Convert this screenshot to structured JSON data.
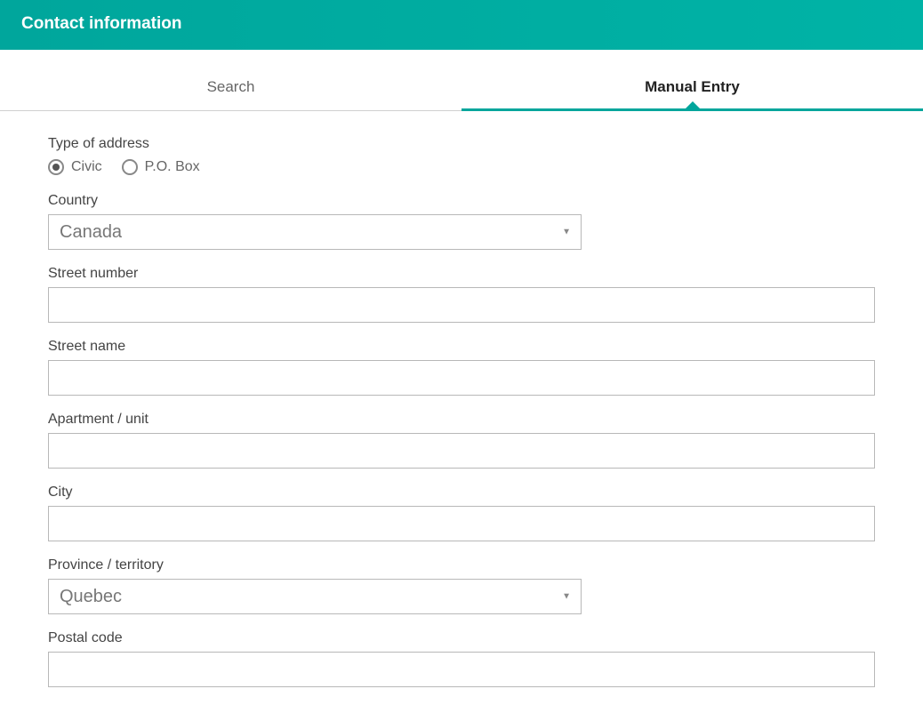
{
  "header": {
    "title": "Contact information"
  },
  "tabs": {
    "search": "Search",
    "manual": "Manual Entry"
  },
  "form": {
    "type_of_address": {
      "label": "Type of address",
      "options": {
        "civic": "Civic",
        "pobox": "P.O. Box"
      }
    },
    "country": {
      "label": "Country",
      "value": "Canada"
    },
    "street_number": {
      "label": "Street number",
      "value": ""
    },
    "street_name": {
      "label": "Street name",
      "value": ""
    },
    "apartment": {
      "label": "Apartment / unit",
      "value": ""
    },
    "city": {
      "label": "City",
      "value": ""
    },
    "province": {
      "label": "Province / territory",
      "value": "Quebec"
    },
    "postal_code": {
      "label": "Postal code",
      "value": ""
    }
  }
}
